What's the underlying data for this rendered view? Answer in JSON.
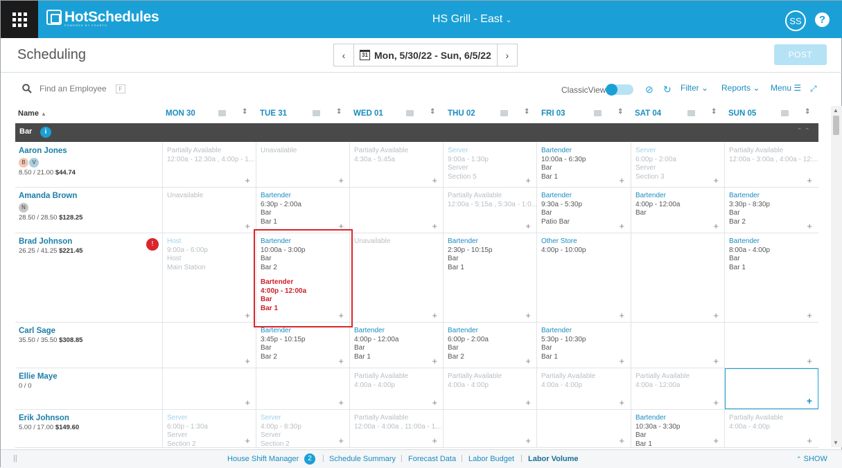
{
  "app": {
    "logo_text": "HotSchedules",
    "logo_sub": "POWERED BY FOURTH",
    "store": "HS Grill - East",
    "avatar": "SS",
    "help": "?"
  },
  "page": {
    "title": "Scheduling",
    "date_range": "Mon, 5/30/22 - Sun, 6/5/22",
    "calendar_day": "31",
    "post_label": "POST"
  },
  "toolbar": {
    "search_placeholder": "Find an Employee",
    "search_key": "F",
    "classic_view": "ClassicView",
    "filter": "Filter",
    "reports": "Reports",
    "menu": "Menu"
  },
  "grid": {
    "name_header": "Name",
    "days": [
      "MON 30",
      "TUE 31",
      "WED 01",
      "THU 02",
      "FRI 03",
      "SAT 04",
      "SUN 05"
    ],
    "group": "Bar",
    "employees": [
      {
        "name": "Aaron Jones",
        "badges": [
          "B",
          "V"
        ],
        "wage": "8.50 / 21.00",
        "cost": "$44.74",
        "cells": [
          {
            "type": "pa",
            "lines": [
              "Partially Available",
              "12:00a - 12:30a , 4:00p - 1..."
            ]
          },
          {
            "type": "pa",
            "lines": [
              "Unavailable"
            ]
          },
          {
            "type": "pa",
            "lines": [
              "Partially Available",
              "4:30a - 5:45a"
            ]
          },
          {
            "type": "faded",
            "lines": [
              "Server",
              "9:00a - 1:30p",
              "Server",
              "Section 5"
            ]
          },
          {
            "type": "shift",
            "lines": [
              "Bartender",
              "10:00a - 6:30p",
              "Bar",
              "Bar 1"
            ]
          },
          {
            "type": "faded",
            "lines": [
              "Server",
              "6:00p - 2:00a",
              "Server",
              "Section 3"
            ]
          },
          {
            "type": "pa",
            "lines": [
              "Partially Available",
              "12:00a - 3:00a , 4:00a - 12:..."
            ]
          }
        ]
      },
      {
        "name": "Amanda Brown",
        "badges": [
          "N"
        ],
        "wage": "28.50 / 28.50",
        "cost": "$128.25",
        "cells": [
          {
            "type": "pa",
            "lines": [
              "Unavailable"
            ]
          },
          {
            "type": "shift",
            "lines": [
              "Bartender",
              "6:30p - 2:00a",
              "Bar",
              "Bar 1"
            ]
          },
          {
            "type": "empty",
            "lines": []
          },
          {
            "type": "pa",
            "lines": [
              "Partially Available",
              "12:00a - 5:15a , 5:30a - 1:0..."
            ]
          },
          {
            "type": "shift",
            "lines": [
              "Bartender",
              "9:30a - 5:30p",
              "Bar",
              "Patio Bar"
            ]
          },
          {
            "type": "shift",
            "lines": [
              "Bartender",
              "4:00p - 12:00a",
              "Bar"
            ]
          },
          {
            "type": "shift",
            "lines": [
              "Bartender",
              "3:30p - 8:30p",
              "Bar",
              "Bar 2"
            ]
          }
        ]
      },
      {
        "name": "Brad Johnson",
        "badges": [],
        "wage": "26.25 / 41.25",
        "cost": "$221.45",
        "alert": "!",
        "cells": [
          {
            "type": "faded",
            "lines": [
              "Host",
              "9:00a - 6:00p",
              "Host",
              "Main Station"
            ]
          },
          {
            "type": "shift",
            "lines": [
              "Bartender",
              "10:00a - 3:00p",
              "Bar",
              "Bar 2"
            ],
            "conflict": [
              "Bartender",
              "4:00p - 12:00a",
              "Bar",
              "Bar 1"
            ]
          },
          {
            "type": "pa",
            "lines": [
              "Unavailable"
            ]
          },
          {
            "type": "shift",
            "lines": [
              "Bartender",
              "2:30p - 10:15p",
              "Bar",
              "Bar 1"
            ]
          },
          {
            "type": "shift",
            "lines": [
              "Other Store",
              "4:00p - 10:00p"
            ]
          },
          {
            "type": "empty",
            "lines": []
          },
          {
            "type": "shift",
            "lines": [
              "Bartender",
              "8:00a - 4:00p",
              "Bar",
              "Bar 1"
            ]
          }
        ]
      },
      {
        "name": "Carl Sage",
        "badges": [],
        "wage": "35.50 / 35.50",
        "cost": "$308.85",
        "cells": [
          {
            "type": "empty",
            "lines": []
          },
          {
            "type": "shift",
            "lines": [
              "Bartender",
              "3:45p - 10:15p",
              "Bar",
              "Bar 2"
            ]
          },
          {
            "type": "shift",
            "lines": [
              "Bartender",
              "4:00p - 12:00a",
              "Bar",
              "Bar 1"
            ]
          },
          {
            "type": "shift",
            "lines": [
              "Bartender",
              "6:00p - 2:00a",
              "Bar",
              "Bar 2"
            ]
          },
          {
            "type": "shift",
            "lines": [
              "Bartender",
              "5:30p - 10:30p",
              "Bar",
              "Bar 1"
            ]
          },
          {
            "type": "empty",
            "lines": []
          },
          {
            "type": "empty",
            "lines": []
          }
        ]
      },
      {
        "name": "Ellie Maye",
        "badges": [],
        "wage": "0 / 0",
        "cost": "",
        "cells": [
          {
            "type": "empty",
            "lines": []
          },
          {
            "type": "empty",
            "lines": []
          },
          {
            "type": "pa",
            "lines": [
              "Partially Available",
              "4:00a - 4:00p"
            ]
          },
          {
            "type": "pa",
            "lines": [
              "Partially Available",
              "4:00a - 4:00p"
            ]
          },
          {
            "type": "pa",
            "lines": [
              "Partially Available",
              "4:00a - 4:00p"
            ]
          },
          {
            "type": "pa",
            "lines": [
              "Partially Available",
              "4:00a - 12:00a"
            ]
          },
          {
            "type": "empty",
            "lines": []
          }
        ]
      },
      {
        "name": "Erik Johnson",
        "badges": [],
        "wage": "5.00 / 17.00",
        "cost": "$149.60",
        "cells": [
          {
            "type": "faded",
            "lines": [
              "Server",
              "6:00p - 1:30a",
              "Server",
              "Section 2"
            ]
          },
          {
            "type": "faded",
            "lines": [
              "Server",
              "4:00p - 8:30p",
              "Server",
              "Section 2"
            ]
          },
          {
            "type": "pa",
            "lines": [
              "Partially Available",
              "12:00a - 4:00a , 11:00a - 1..."
            ]
          },
          {
            "type": "empty",
            "lines": []
          },
          {
            "type": "empty",
            "lines": []
          },
          {
            "type": "shift",
            "lines": [
              "Bartender",
              "10:30a - 3:30p",
              "Bar",
              "Bar 1"
            ]
          },
          {
            "type": "pa",
            "lines": [
              "Partially Available",
              "4:00a - 4:00p"
            ]
          }
        ]
      }
    ]
  },
  "footer": {
    "items": [
      "House Shift Manager",
      "Schedule Summary",
      "Forecast Data",
      "Labor Budget",
      "Labor Volume"
    ],
    "badge": "2",
    "show": "SHOW"
  },
  "colors": {
    "brand": "#1aa0d6",
    "group_bar": "#494949",
    "alert": "#d9262c"
  }
}
